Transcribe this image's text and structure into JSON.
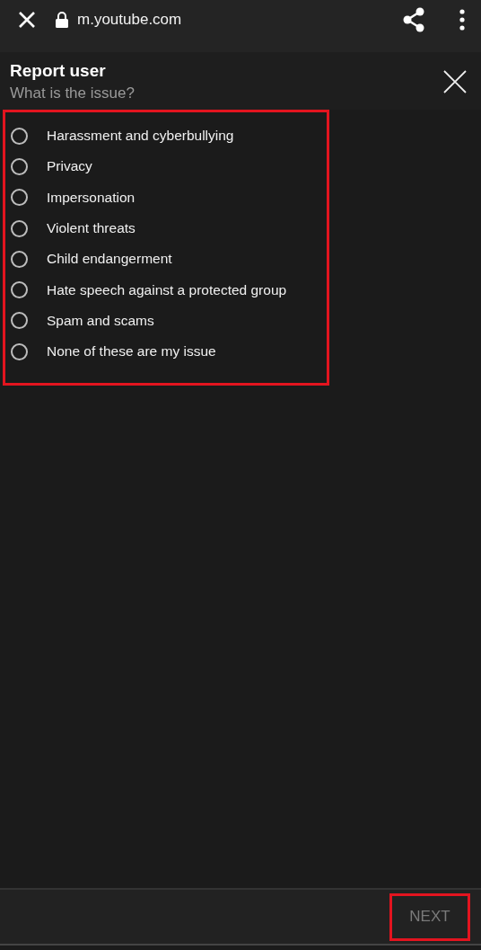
{
  "browser_bar": {
    "url": "m.youtube.com"
  },
  "dialog": {
    "title": "Report user",
    "subtitle": "What is the issue?"
  },
  "options": [
    {
      "label": "Harassment and cyberbullying",
      "selected": false
    },
    {
      "label": "Privacy",
      "selected": false
    },
    {
      "label": "Impersonation",
      "selected": false
    },
    {
      "label": "Violent threats",
      "selected": false
    },
    {
      "label": "Child endangerment",
      "selected": false
    },
    {
      "label": "Hate speech against a protected group",
      "selected": false
    },
    {
      "label": "Spam and scams",
      "selected": false
    },
    {
      "label": "None of these are my issue",
      "selected": false
    }
  ],
  "next_button": {
    "label": "NEXT",
    "disabled": true
  }
}
